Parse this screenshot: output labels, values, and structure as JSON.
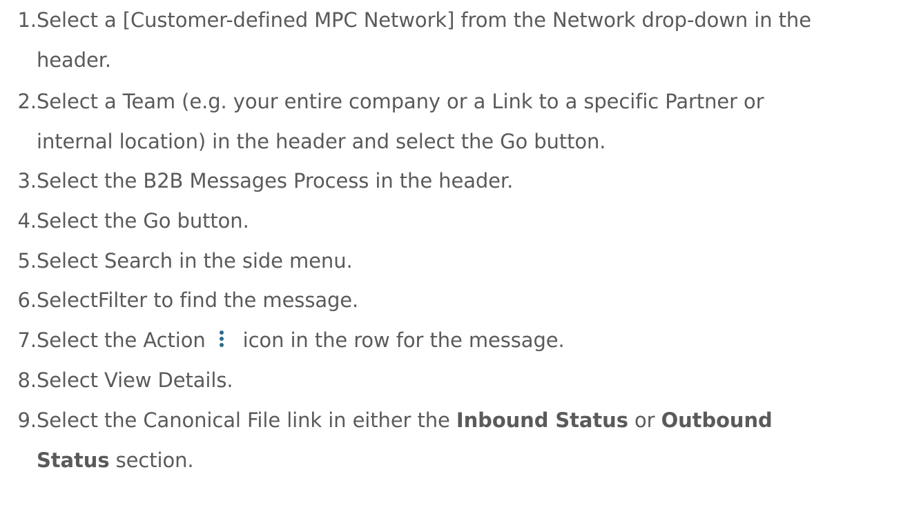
{
  "steps": [
    {
      "number": "1.",
      "lines": [
        "Select a [Customer-defined MPC Network] from the Network drop-down in the",
        "header."
      ]
    },
    {
      "number": "2.",
      "lines": [
        "Select a Team (e.g. your entire company or a Link to a specific Partner or",
        "internal location) in the header and select the Go button."
      ]
    },
    {
      "number": "3.",
      "lines": [
        "Select the B2B Messages Process in the header."
      ]
    },
    {
      "number": "4.",
      "lines": [
        "Select the Go button."
      ]
    },
    {
      "number": "5.",
      "lines": [
        "Select Search in the side menu."
      ]
    },
    {
      "number": "6.",
      "lines": [
        "SelectFilter to find the message."
      ]
    },
    {
      "number": "7.",
      "before_icon": "Select the Action",
      "icon": "vertical-ellipsis-icon",
      "after_icon": "icon in the row for the message."
    },
    {
      "number": "8.",
      "lines": [
        "Select View Details."
      ]
    },
    {
      "number": "9.",
      "part1": "Select the Canonical File link in either the ",
      "bold1": "Inbound Status",
      "part2": " or ",
      "bold2": "Outbound",
      "bold3": "Status",
      "part3": " section."
    }
  ],
  "colors": {
    "text": "#5a5a5a",
    "icon": "#2f6b8c"
  }
}
